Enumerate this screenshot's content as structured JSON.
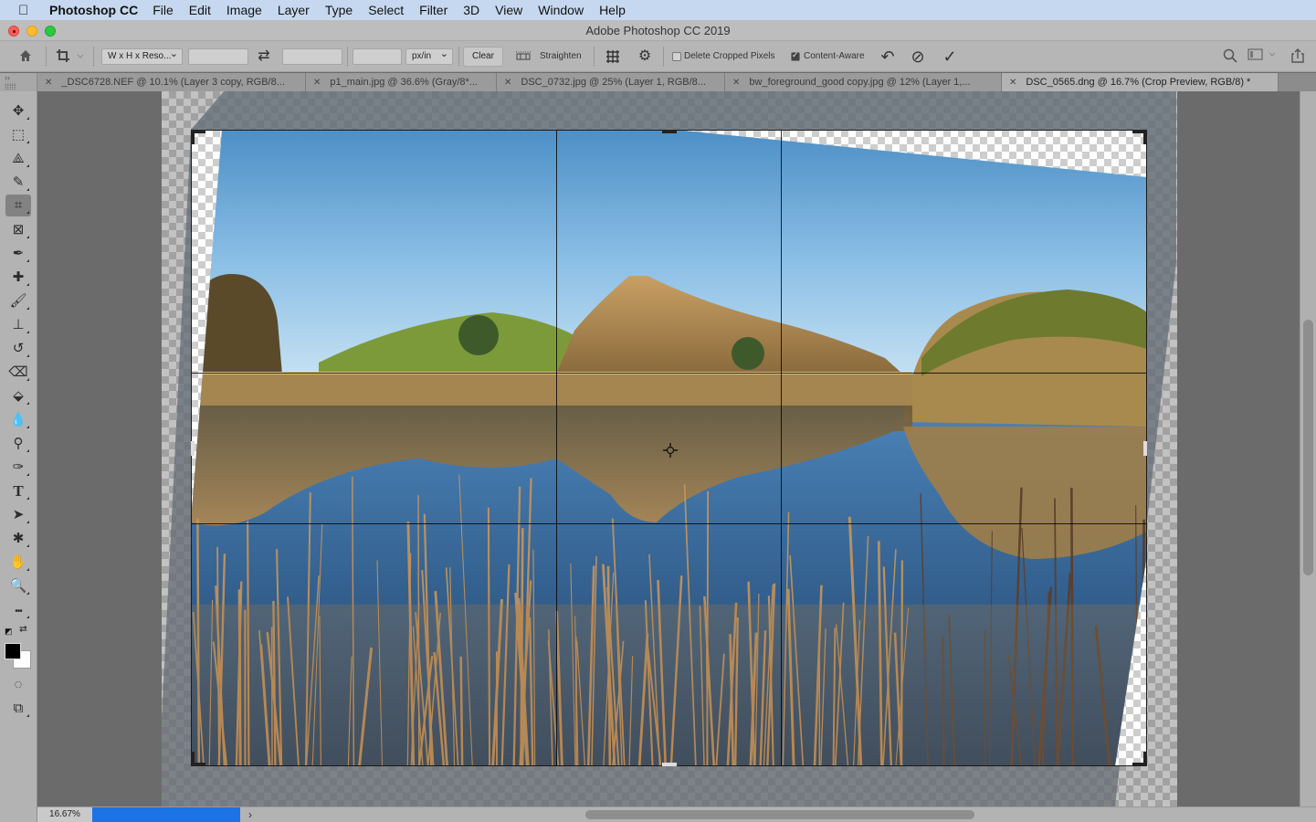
{
  "menubar": {
    "apple_icon": "apple-logo-icon",
    "app_name": "Photoshop CC",
    "items": [
      "File",
      "Edit",
      "Image",
      "Layer",
      "Type",
      "Select",
      "Filter",
      "3D",
      "View",
      "Window",
      "Help"
    ]
  },
  "window": {
    "title": "Adobe Photoshop CC 2019"
  },
  "options_bar": {
    "home_icon": "home-icon",
    "tool_preset_icon": "crop-tool-icon",
    "ratio_select": "W x H x Reso...",
    "width_value": "",
    "swap_icon": "swap-arrows-icon",
    "height_value": "",
    "resolution_value": "",
    "resolution_unit": "px/in",
    "clear_label": "Clear",
    "straighten_label": "Straighten",
    "overlay_icon": "grid-overlay-icon",
    "settings_icon": "gear-icon",
    "delete_cropped_label": "Delete Cropped Pixels",
    "delete_cropped_checked": false,
    "content_aware_label": "Content-Aware",
    "content_aware_checked": true,
    "reset_icon": "reset-icon",
    "cancel_icon": "cancel-icon",
    "commit_icon": "checkmark-icon",
    "search_icon": "search-icon",
    "workspace_icon": "workspace-icon",
    "share_icon": "share-icon"
  },
  "tabs": [
    {
      "label": "_DSC6728.NEF @ 10.1% (Layer 3 copy, RGB/8...",
      "active": false
    },
    {
      "label": "p1_main.jpg @ 36.6% (Gray/8*...",
      "active": false
    },
    {
      "label": "DSC_0732.jpg @ 25% (Layer 1, RGB/8...",
      "active": false
    },
    {
      "label": "bw_foreground_good copy.jpg @ 12% (Layer 1,...",
      "active": false
    },
    {
      "label": "DSC_0565.dng @ 16.7% (Crop Preview, RGB/8) *",
      "active": true
    }
  ],
  "tools": [
    {
      "name": "move-tool",
      "icon": "move-icon",
      "glyph": "✥"
    },
    {
      "name": "marquee-tool",
      "icon": "rect-marquee-icon",
      "glyph": "⬚"
    },
    {
      "name": "lasso-tool",
      "icon": "polygonal-lasso-icon",
      "glyph": "⟁"
    },
    {
      "name": "quick-select-tool",
      "icon": "quick-select-icon",
      "glyph": "✎"
    },
    {
      "name": "crop-tool",
      "icon": "crop-icon",
      "glyph": "⌗",
      "active": true
    },
    {
      "name": "frame-tool",
      "icon": "frame-icon",
      "glyph": "⊠"
    },
    {
      "name": "eyedropper-tool",
      "icon": "eyedropper-icon",
      "glyph": "✒"
    },
    {
      "name": "healing-tool",
      "icon": "healing-brush-icon",
      "glyph": "✚"
    },
    {
      "name": "brush-tool",
      "icon": "brush-icon",
      "glyph": "🖌"
    },
    {
      "name": "stamp-tool",
      "icon": "clone-stamp-icon",
      "glyph": "⊥"
    },
    {
      "name": "history-brush-tool",
      "icon": "history-brush-icon",
      "glyph": "↺"
    },
    {
      "name": "eraser-tool",
      "icon": "eraser-icon",
      "glyph": "⌫"
    },
    {
      "name": "paint-bucket-tool",
      "icon": "paint-bucket-icon",
      "glyph": "⬙"
    },
    {
      "name": "blur-tool",
      "icon": "blur-drop-icon",
      "glyph": "💧"
    },
    {
      "name": "dodge-tool",
      "icon": "dodge-icon",
      "glyph": "⚲"
    },
    {
      "name": "pen-tool",
      "icon": "pen-icon",
      "glyph": "✑"
    },
    {
      "name": "type-tool",
      "icon": "type-icon",
      "glyph": "T"
    },
    {
      "name": "path-select-tool",
      "icon": "path-select-arrow-icon",
      "glyph": "➤"
    },
    {
      "name": "shape-tool",
      "icon": "custom-shape-icon",
      "glyph": "✱"
    },
    {
      "name": "hand-tool",
      "icon": "hand-icon",
      "glyph": "✋"
    },
    {
      "name": "zoom-tool",
      "icon": "zoom-icon",
      "glyph": "🔍"
    },
    {
      "name": "more-tools",
      "icon": "ellipsis-icon",
      "glyph": "•••"
    }
  ],
  "colors": {
    "foreground": "#000000",
    "background": "#ffffff",
    "accent_progress": "#1b73e6"
  },
  "bottom_tools": [
    {
      "name": "quick-mask-button",
      "icon": "quick-mask-icon",
      "glyph": "◌"
    },
    {
      "name": "screen-mode-button",
      "icon": "screen-mode-icon",
      "glyph": "⧉"
    }
  ],
  "status": {
    "zoom": "16.67%",
    "progress": 0.95,
    "arrow": "›"
  },
  "crop": {
    "grid": "rule-of-thirds",
    "straighten_angle_deg": -3.5
  }
}
